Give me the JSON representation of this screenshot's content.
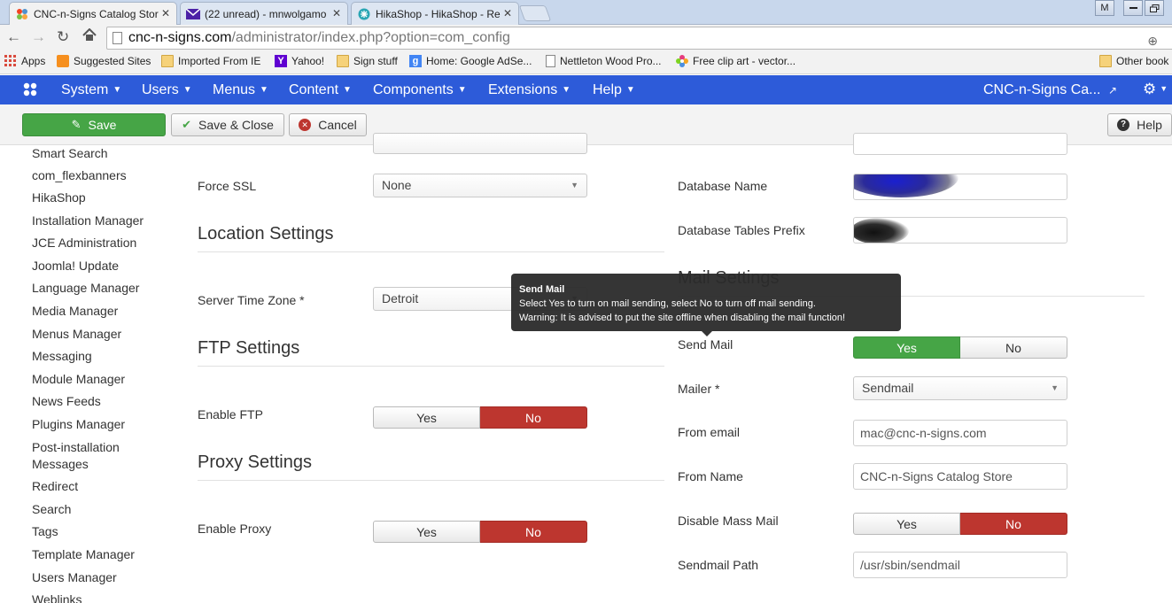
{
  "browser": {
    "tabs": [
      {
        "title": "CNC-n-Signs Catalog Stor",
        "icon": "joomla-icon"
      },
      {
        "title": "(22 unread) - mnwolgamo",
        "icon": "mail-icon"
      },
      {
        "title": "HikaShop - HikaShop - Re",
        "icon": "hikashop-icon"
      }
    ],
    "tab_close": "✕",
    "profile_badge": "M",
    "url_host": "cnc-n-signs.com",
    "url_path": "/administrator/index.php?option=com_config",
    "bookmarks": [
      {
        "label": "Apps",
        "icon": "apps-grid-icon"
      },
      {
        "label": "Suggested Sites",
        "icon": "suggested-icon"
      },
      {
        "label": "Imported From IE",
        "icon": "folder-icon"
      },
      {
        "label": "Yahoo!",
        "icon": "yahoo-icon"
      },
      {
        "label": "Sign stuff",
        "icon": "folder-icon"
      },
      {
        "label": "Home: Google AdSe...",
        "icon": "google-icon"
      },
      {
        "label": "Nettleton Wood Pro...",
        "icon": "page-icon"
      },
      {
        "label": "Free clip art - vector...",
        "icon": "flower-icon"
      }
    ],
    "other_bookmarks": "Other book"
  },
  "navbar": {
    "menus": [
      "System",
      "Users",
      "Menus",
      "Content",
      "Components",
      "Extensions",
      "Help"
    ],
    "site_name": "CNC-n-Signs Ca...",
    "brand_color": "#2d5bd9"
  },
  "toolbar": {
    "save": "Save",
    "save_close": "Save & Close",
    "cancel": "Cancel",
    "help": "Help"
  },
  "sidebar": {
    "items": [
      "Smart Search",
      "com_flexbanners",
      "HikaShop",
      "Installation Manager",
      "JCE Administration",
      "Joomla! Update",
      "Language Manager",
      "Media Manager",
      "Menus Manager",
      "Messaging",
      "Module Manager",
      "News Feeds",
      "Plugins Manager",
      "Post-installation",
      "Messages",
      "Redirect",
      "Search",
      "Tags",
      "Template Manager",
      "Users Manager",
      "Weblinks"
    ]
  },
  "server": {
    "force_ssl_label": "Force SSL",
    "force_ssl_value": "None",
    "location_title": "Location Settings",
    "timezone_label": "Server Time Zone *",
    "timezone_value": "Detroit",
    "ftp_title": "FTP Settings",
    "enable_ftp_label": "Enable FTP",
    "proxy_title": "Proxy Settings",
    "enable_proxy_label": "Enable Proxy",
    "yes": "Yes",
    "no": "No"
  },
  "database": {
    "name_label": "Database Name",
    "prefix_label": "Database Tables Prefix"
  },
  "mail": {
    "title": "Mail Settings",
    "send_mail_label": "Send Mail",
    "mailer_label": "Mailer *",
    "mailer_value": "Sendmail",
    "from_email_label": "From email",
    "from_email_value": "mac@cnc-n-signs.com",
    "from_name_label": "From Name",
    "from_name_value": "CNC-n-Signs Catalog Store",
    "mass_mail_label": "Disable Mass Mail",
    "sendmail_path_label": "Sendmail Path",
    "sendmail_path_value": "/usr/sbin/sendmail",
    "yes": "Yes",
    "no": "No"
  },
  "tooltip": {
    "title": "Send Mail",
    "line1": "Select Yes to turn on mail sending, select No to turn off mail sending.",
    "line2": "Warning: It is advised to put the site offline when disabling the mail function!"
  },
  "colors": {
    "green": "#46a546",
    "red": "#bd362f"
  }
}
